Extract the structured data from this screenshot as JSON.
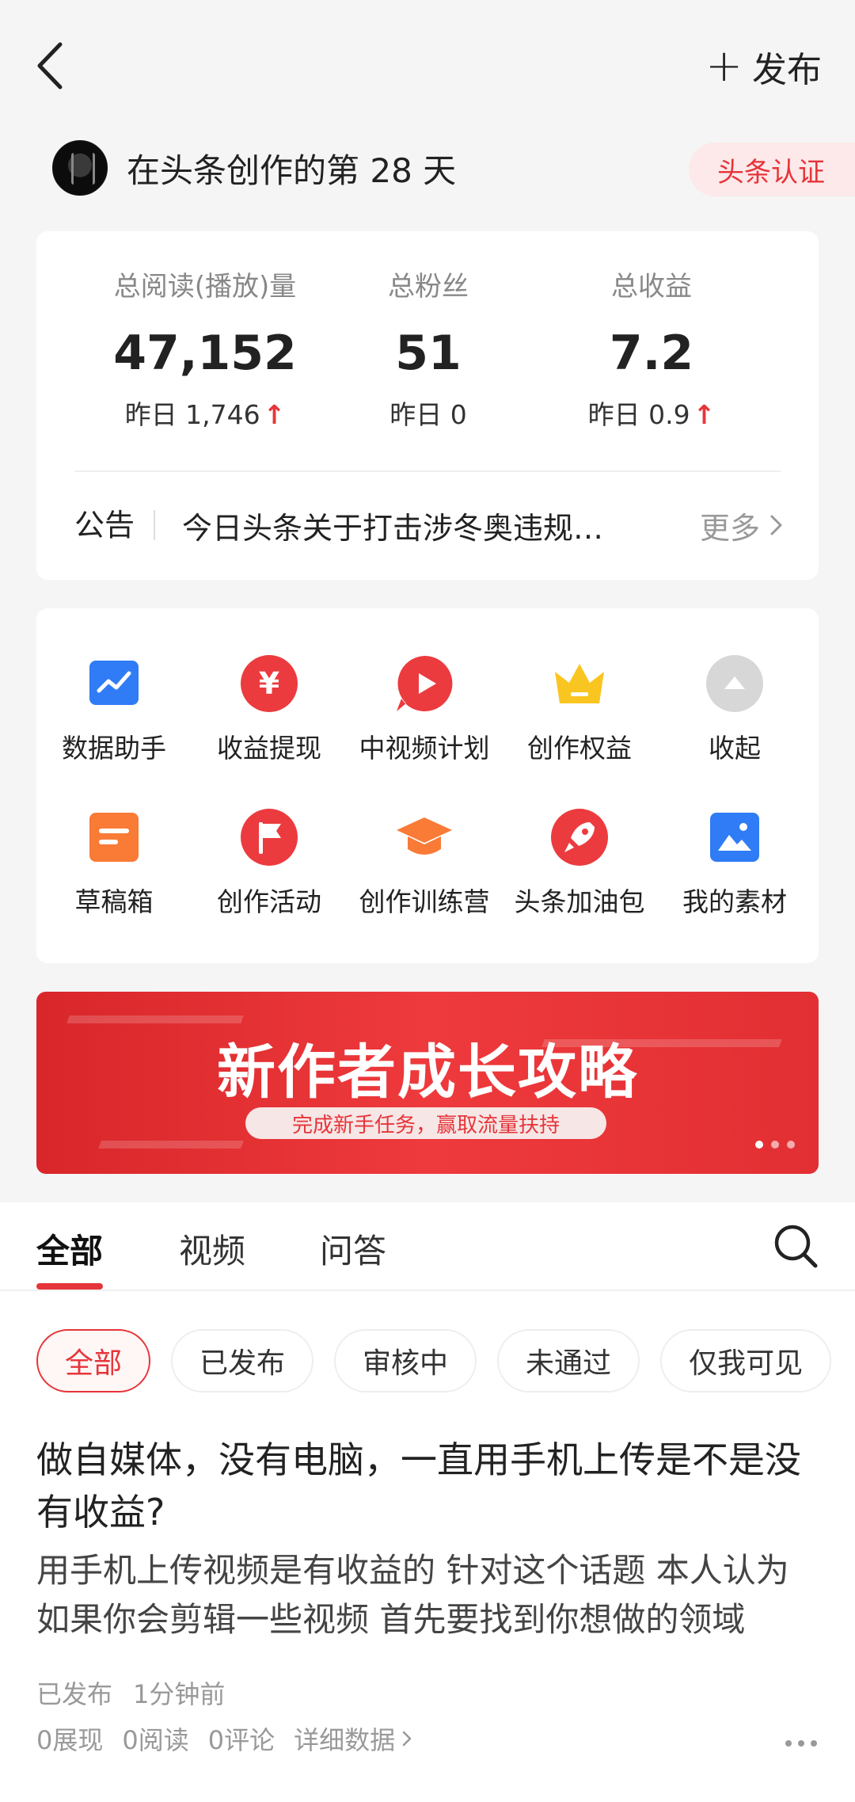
{
  "header": {
    "publish_label": "发布"
  },
  "user": {
    "days_text": "在头条创作的第 28 天",
    "cert_label": "头条认证"
  },
  "stats": [
    {
      "label": "总阅读(播放)量",
      "value": "47,152",
      "yesterday": "昨日 1,746",
      "up": true
    },
    {
      "label": "总粉丝",
      "value": "51",
      "yesterday": "昨日 0",
      "up": false
    },
    {
      "label": "总收益",
      "value": "7.2",
      "yesterday": "昨日 0.9",
      "up": true
    }
  ],
  "notice": {
    "label": "公告",
    "text": "今日头条关于打击涉冬奥违规行为的公告",
    "more": "更多"
  },
  "tools": [
    {
      "label": "数据助手",
      "icon": "chart-icon"
    },
    {
      "label": "收益提现",
      "icon": "yuan-icon"
    },
    {
      "label": "中视频计划",
      "icon": "play-icon"
    },
    {
      "label": "创作权益",
      "icon": "crown-icon"
    },
    {
      "label": "收起",
      "icon": "collapse-icon"
    },
    {
      "label": "草稿箱",
      "icon": "draft-icon"
    },
    {
      "label": "创作活动",
      "icon": "flag-icon"
    },
    {
      "label": "创作训练营",
      "icon": "graduation-cap-icon"
    },
    {
      "label": "头条加油包",
      "icon": "rocket-icon"
    },
    {
      "label": "我的素材",
      "icon": "image-icon"
    }
  ],
  "banner": {
    "title": "新作者成长攻略",
    "subtitle": "完成新手任务，赢取流量扶持",
    "slide_count": 3,
    "active_slide": 1
  },
  "content_tabs": [
    "全部",
    "视频",
    "问答"
  ],
  "filters": [
    "全部",
    "已发布",
    "审核中",
    "未通过",
    "仅我可见"
  ],
  "article": {
    "title": "做自媒体，没有电脑，一直用手机上传是不是没有收益?",
    "body": "用手机上传视频是有收益的 针对这个话题 本人认为如果你会剪辑一些视频 首先要找到你想做的领域",
    "status": "已发布",
    "time": "1分钟前",
    "impressions": "0展现",
    "reads": "0阅读",
    "comments": "0评论",
    "detail_link": "详细数据"
  },
  "colors": {
    "accent": "#e6353a",
    "blue": "#2f7cf6",
    "orange": "#f97b36",
    "yellow": "#f9c521",
    "gray": "#cfcfcf"
  }
}
